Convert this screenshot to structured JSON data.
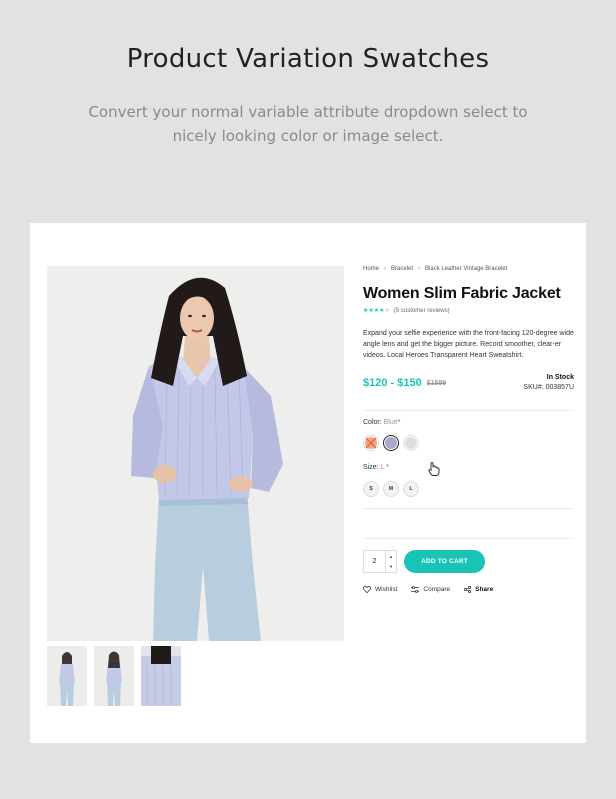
{
  "hero": {
    "title": "Product Variation Swatches",
    "subtitle": "Convert your normal variable attribute dropdown select to nicely looking color or image select."
  },
  "product": {
    "breadcrumb": [
      "Home",
      "Bracelet",
      "Black Leather Vintage Bracelet"
    ],
    "title": "Women Slim Fabric Jacket",
    "rating": {
      "stars": 4,
      "max": 5,
      "reviews_text": "(5 customer reviews)"
    },
    "description": "Expand your selfie experience with the front-facing 120-degree wide angle lens and get the bigger picture. Record smoother, clear-er videos. Local Heroes Transparent Heart Sweatshirt.",
    "price": "$120 - $150",
    "old_price": "$1599",
    "stock": "In Stock",
    "sku": "SKU#: 003857U",
    "color_label": "Color:",
    "color_value": "Blue",
    "required_mark": "*",
    "colors": [
      {
        "name": "orange",
        "hex": "#f4a67c",
        "unavailable": true
      },
      {
        "name": "blue",
        "hex": "#a8a9cf",
        "selected": true
      },
      {
        "name": "grey",
        "hex": "#dddddd"
      }
    ],
    "size_label": "Size:",
    "size_value": "L",
    "sizes": [
      "S",
      "M",
      "L"
    ],
    "quantity": "2",
    "add_to_cart": "ADD TO CART",
    "actions": {
      "wishlist": "Wishlist",
      "compare": "Compare",
      "share": "Share"
    }
  },
  "colors": {
    "accent": "#19c4b6",
    "background": "#e2e2e2",
    "card": "#ffffff",
    "required": "#e33333"
  }
}
